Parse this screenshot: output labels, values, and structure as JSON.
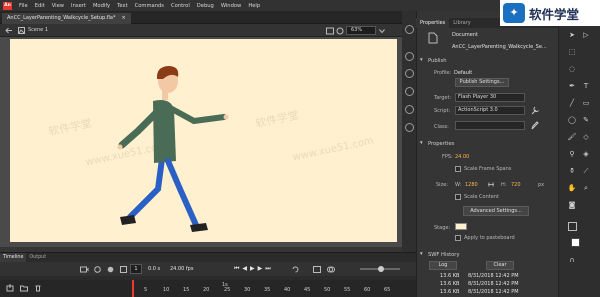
{
  "menubar": {
    "logo": "An",
    "items": [
      "File",
      "Edit",
      "View",
      "Insert",
      "Modify",
      "Text",
      "Commands",
      "Control",
      "Debug",
      "Window",
      "Help"
    ]
  },
  "document": {
    "tab_title": "AnCC_LayerParenting_Walkcycle_Setup.fla*",
    "tab_close": "×",
    "scene": "Scene 1",
    "zoom": "63%"
  },
  "properties": {
    "tabs": [
      "Properties",
      "Library"
    ],
    "doc_type": "Document",
    "doc_name": "AnCC_LayerParenting_Walkcycle_Se...",
    "publish": {
      "section": "Publish",
      "profile_label": "Profile:",
      "profile_value": "Default",
      "publish_settings_button": "Publish Settings...",
      "target_label": "Target:",
      "target_value": "Flash Player 30",
      "script_label": "Script:",
      "script_value": "ActionScript 3.0",
      "class_label": "Class:",
      "class_value": ""
    },
    "props": {
      "section": "Properties",
      "fps_label": "FPS:",
      "fps_value": "24.00",
      "scale_frame_spans": "Scale Frame Spans",
      "size_label": "Size:",
      "w_label": "W:",
      "w_value": "1280",
      "h_label": "H:",
      "h_value": "720",
      "unit": "px",
      "scale_content": "Scale Content",
      "advanced_settings_button": "Advanced Settings...",
      "stage_label": "Stage:",
      "stage_color": "#fff1cf",
      "apply_to_pasteboard": "Apply to pasteboard"
    },
    "history": {
      "section": "SWF History",
      "log_button": "Log",
      "clear_button": "Clear",
      "rows": [
        {
          "size": "13.6 KB",
          "date": "8/31/2018 12:42 PM"
        },
        {
          "size": "13.6 KB",
          "date": "8/31/2018 12:42 PM"
        },
        {
          "size": "13.6 KB",
          "date": "8/31/2018 12:42 PM"
        }
      ]
    }
  },
  "watermark": {
    "brand": "软件学堂",
    "faint_text": "软件学堂",
    "faint_url": "www.xue51.com"
  },
  "timeline": {
    "tabs": [
      "Timeline",
      "Output"
    ],
    "time": "0.0 s",
    "fps": "24.00 fps",
    "frame_numbers": [
      "1s",
      "5",
      "10",
      "15",
      "20",
      "25",
      "30",
      "35",
      "40",
      "45",
      "50",
      "55",
      "60",
      "65"
    ],
    "current_frame": "1"
  },
  "colors": {
    "stage_bg": "#fff1cf",
    "character_hair": "#8b3b16",
    "character_shirt": "#4a6b55",
    "character_pants": "#2a5fc6",
    "accent_red": "#e8372c"
  },
  "icons": {
    "tools": [
      "selection-arrow-icon",
      "subselection-icon",
      "free-transform-icon",
      "lasso-icon",
      "pen-icon",
      "text-icon",
      "line-icon",
      "rectangle-icon",
      "oval-icon",
      "pencil-icon",
      "brush-icon",
      "eraser-icon",
      "bone-icon",
      "paint-bucket-icon",
      "ink-bottle-icon",
      "eyedropper-icon",
      "hand-icon",
      "zoom-icon",
      "camera-icon"
    ]
  }
}
